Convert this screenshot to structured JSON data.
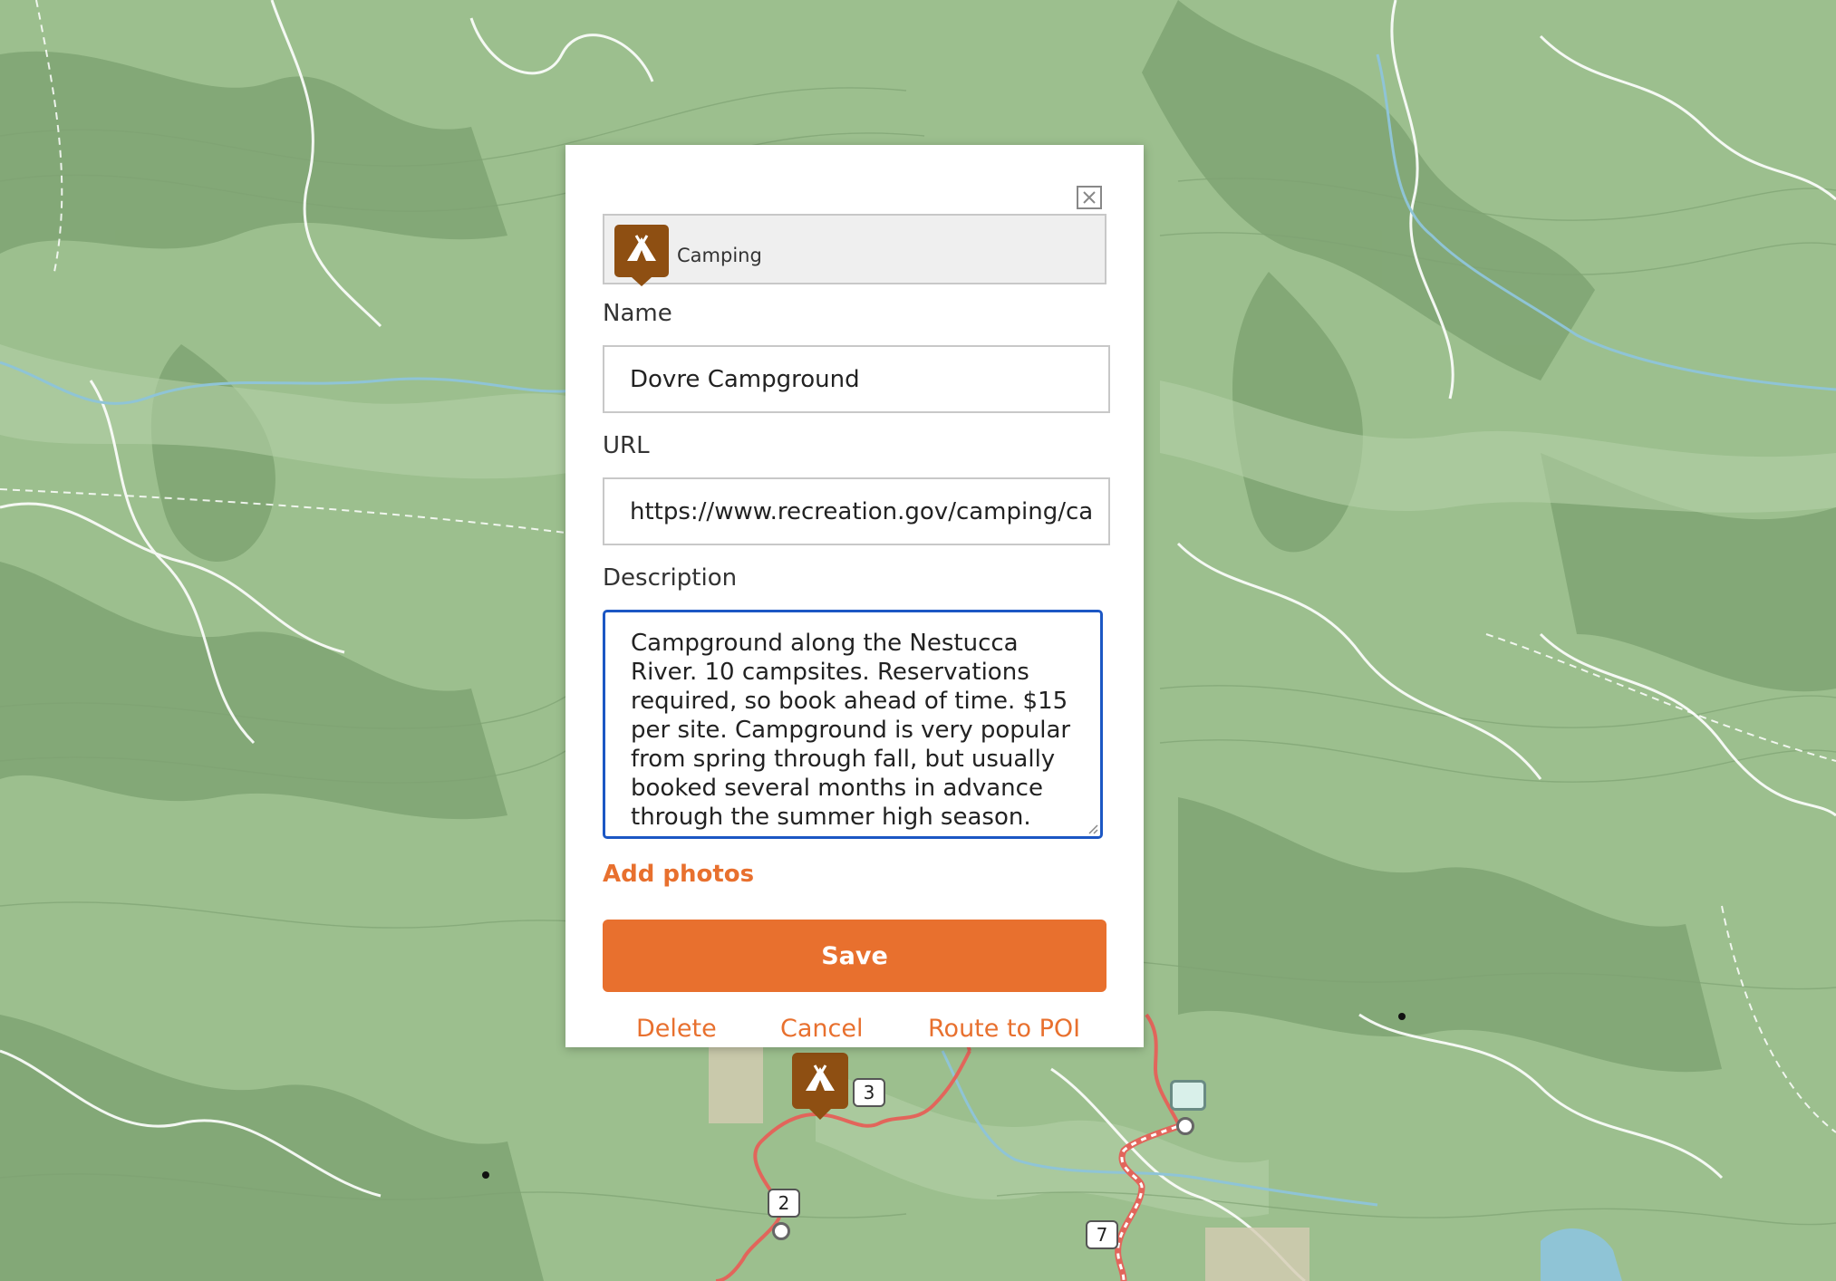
{
  "map": {
    "route_markers": [
      "3",
      "2",
      "7"
    ]
  },
  "poi_dialog": {
    "category": {
      "label": "Camping",
      "icon": "tent-icon",
      "icon_color": "#8e4f12"
    },
    "name_field": {
      "label": "Name",
      "value": "Dovre Campground"
    },
    "url_field": {
      "label": "URL",
      "value": "https://www.recreation.gov/camping/ca"
    },
    "description_field": {
      "label": "Description",
      "value": "Campground along the Nestucca River. 10 campsites. Reservations required, so book ahead of time. $15 per site. Campground is very popular from spring through fall, but usually booked several months in advance through the summer high season."
    },
    "add_photos_label": "Add photos",
    "save_label": "Save",
    "delete_label": "Delete",
    "cancel_label": "Cancel",
    "route_label": "Route to POI",
    "accent_color": "#e8702e",
    "focus_color": "#1c57c4"
  }
}
